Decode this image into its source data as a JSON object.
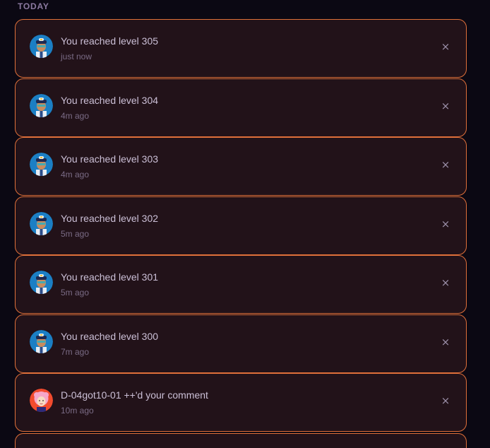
{
  "section": {
    "label": "TODAY"
  },
  "notifications": [
    {
      "title": "You reached level 305",
      "time": "just now",
      "avatar": "police-officer-avatar",
      "close": "×"
    },
    {
      "title": "You reached level 304",
      "time": "4m ago",
      "avatar": "police-officer-avatar",
      "close": "×"
    },
    {
      "title": "You reached level 303",
      "time": "4m ago",
      "avatar": "police-officer-avatar",
      "close": "×"
    },
    {
      "title": "You reached level 302",
      "time": "5m ago",
      "avatar": "police-officer-avatar",
      "close": "×"
    },
    {
      "title": "You reached level 301",
      "time": "5m ago",
      "avatar": "police-officer-avatar",
      "close": "×"
    },
    {
      "title": "You reached level 300",
      "time": "7m ago",
      "avatar": "police-officer-avatar",
      "close": "×"
    },
    {
      "title": "D-04got10-01 ++'d your comment",
      "time": "10m ago",
      "avatar": "pink-haired-user-avatar",
      "close": "×"
    }
  ],
  "colors": {
    "background": "#0b0813",
    "card_background": "#221219",
    "card_border": "#e0703a",
    "title_text": "#cbbfd6",
    "time_text": "#7a6b85",
    "section_label": "#8c7aa0"
  }
}
